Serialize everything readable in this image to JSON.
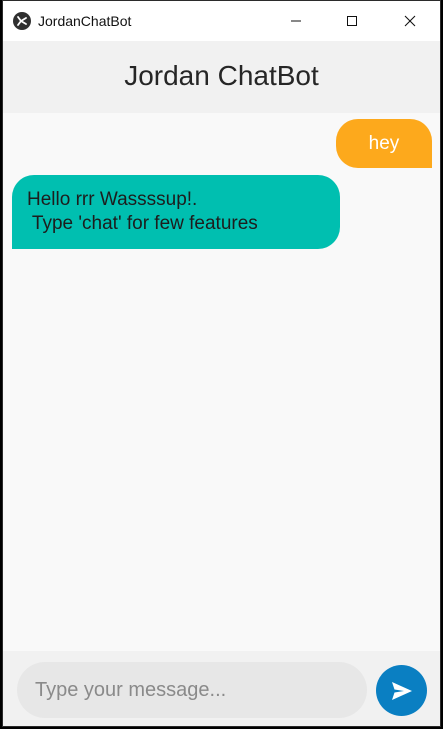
{
  "window": {
    "title": "JordanChatBot",
    "icon": "kivy-app-icon",
    "controls": [
      "minimize",
      "maximize",
      "close"
    ]
  },
  "header": {
    "title": "Jordan ChatBot"
  },
  "messages": [
    {
      "sender": "user",
      "text": "hey",
      "color": "#fda91c"
    },
    {
      "sender": "bot",
      "text": "Hello rrr Wassssup!.\n Type 'chat' for few features",
      "color": "#00bfb0"
    }
  ],
  "composer": {
    "placeholder": "Type your message...",
    "value": "",
    "send_icon": "send-icon",
    "send_color": "#0a7fc2"
  }
}
